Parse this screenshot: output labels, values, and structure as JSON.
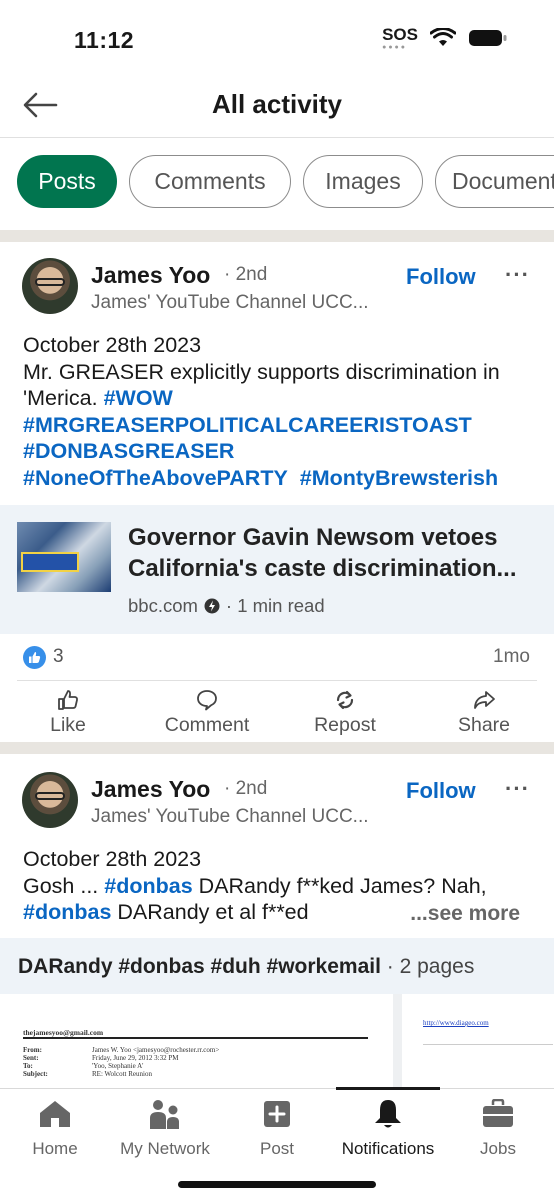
{
  "status_bar": {
    "time": "11:12",
    "sos": "SOS"
  },
  "header": {
    "title": "All activity"
  },
  "filters": [
    {
      "label": "Posts",
      "active": true
    },
    {
      "label": "Comments",
      "active": false
    },
    {
      "label": "Images",
      "active": false
    },
    {
      "label": "Documents",
      "active": false
    }
  ],
  "posts": [
    {
      "author": "James Yoo",
      "degree": "· 2nd",
      "subtitle": "James' YouTube Channel UCC...",
      "follow": "Follow",
      "more": "···",
      "date_line": "October 28th 2023",
      "text_a": "Mr. GREASER explicitly supports discrimination in 'Merica. ",
      "tags": [
        "#WOW",
        "#MRGREASERPOLITICALCAREERISTOAST",
        "#DONBASGREASER",
        "#NoneOfTheAbovePARTY",
        "#MontyBrewsterish"
      ],
      "link": {
        "title": "Governor Gavin Newsom vetoes California's caste discrimination...",
        "source": "bbc.com",
        "read_time": "· 1 min read"
      },
      "reaction_count": "3",
      "time": "1mo",
      "actions": [
        "Like",
        "Comment",
        "Repost",
        "Share"
      ]
    },
    {
      "author": "James Yoo",
      "degree": "· 2nd",
      "subtitle": "James' YouTube Channel UCC...",
      "follow": "Follow",
      "more": "···",
      "date_line": "October 28th 2023",
      "text_a": "Gosh ... ",
      "tag_1": "#donbas",
      "text_b": " DARandy f**ked James?  Nah,",
      "tag_2": "#donbas",
      "text_c": " DARandy et al f**ed",
      "see_more": "...see more",
      "document": {
        "title": "DARandy #donbas #duh #workemail",
        "pages": " · 2 pages",
        "email": "thejamesyoo@gmail.com",
        "fields": {
          "from_label": "From:",
          "from": "James W. Yoo <jamesyoo@rochester.rr.com>",
          "sent_label": "Sent:",
          "sent": "Friday, June 29, 2012 3:32 PM",
          "to_label": "To:",
          "to": "'Yoo, Stephanie A'",
          "subject_label": "Subject:",
          "subject": "RE: Wolcott Reunion"
        },
        "page2_link": "http://www.diageo.com"
      }
    }
  ],
  "tabs": [
    {
      "label": "Home",
      "icon": "home-icon"
    },
    {
      "label": "My Network",
      "icon": "network-icon"
    },
    {
      "label": "Post",
      "icon": "plus-square-icon"
    },
    {
      "label": "Notifications",
      "icon": "bell-icon",
      "active": true
    },
    {
      "label": "Jobs",
      "icon": "briefcase-icon"
    }
  ],
  "colors": {
    "accent_green": "#01754f",
    "link_blue": "#0a66c2"
  }
}
